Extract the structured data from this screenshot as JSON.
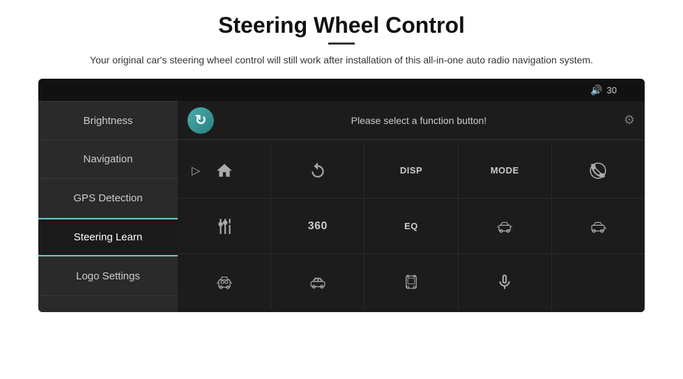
{
  "header": {
    "title": "Steering Wheel Control",
    "divider": true,
    "subtitle": "Your original car's steering wheel control will still work after installation of this all-in-one auto radio navigation system."
  },
  "topbar": {
    "volume_icon": "🔊",
    "volume_value": "30"
  },
  "sidebar": {
    "items": [
      {
        "id": "brightness",
        "label": "Brightness",
        "active": false
      },
      {
        "id": "navigation",
        "label": "Navigation",
        "active": false
      },
      {
        "id": "gps-detection",
        "label": "GPS Detection",
        "active": false
      },
      {
        "id": "steering-learn",
        "label": "Steering Learn",
        "active": true
      },
      {
        "id": "logo-settings",
        "label": "Logo Settings",
        "active": false
      }
    ]
  },
  "right_panel": {
    "header_text": "Please select a function button!",
    "refresh_title": "refresh",
    "grid": {
      "row1": [
        "home",
        "back",
        "DISP",
        "MODE",
        "no-phone"
      ],
      "row2": [
        "tune",
        "360",
        "EQ",
        "car-360-1",
        "car-360-2"
      ],
      "row3": [
        "car-front",
        "car-side",
        "car-top",
        "mic",
        ""
      ]
    }
  }
}
